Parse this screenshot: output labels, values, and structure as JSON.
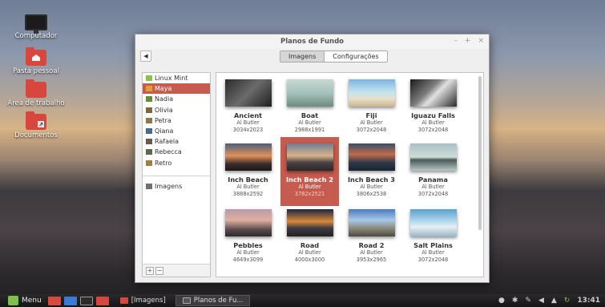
{
  "desktop": {
    "icons": [
      {
        "label": "Computador",
        "icon": "computer-icon"
      },
      {
        "label": "Pasta pessoal",
        "icon": "home-folder-icon"
      },
      {
        "label": "Área de trabalho",
        "icon": "folder-icon"
      },
      {
        "label": "Documentos",
        "icon": "folder-link-icon"
      }
    ]
  },
  "window": {
    "title": "Planos de Fundo",
    "controls": {
      "minimize": "–",
      "maximize": "+",
      "close": "×"
    },
    "back": "◀",
    "tabs": [
      {
        "label": "Imagens",
        "active": true
      },
      {
        "label": "Configurações",
        "active": false
      }
    ]
  },
  "sidebar": {
    "items": [
      {
        "label": "Linux Mint",
        "color": "#8bc34a"
      },
      {
        "label": "Maya",
        "color": "#e0a030",
        "selected": true
      },
      {
        "label": "Nadia",
        "color": "#6a8a3a"
      },
      {
        "label": "Olivia",
        "color": "#7a6a3a"
      },
      {
        "label": "Petra",
        "color": "#8a7a4a"
      },
      {
        "label": "Qiana",
        "color": "#4a6a8a"
      },
      {
        "label": "Rafaela",
        "color": "#6a5a4a"
      },
      {
        "label": "Rebecca",
        "color": "#5a6a4a"
      },
      {
        "label": "Retro",
        "color": "#a08040"
      }
    ],
    "user_items": [
      {
        "label": "Imagens",
        "color": "#707070"
      }
    ],
    "add": "+",
    "remove": "−"
  },
  "wallpapers": [
    {
      "name": "Ancient",
      "author": "Al Butler",
      "size": "3034x2023"
    },
    {
      "name": "Boat",
      "author": "Al Butler",
      "size": "2988x1991"
    },
    {
      "name": "Fiji",
      "author": "Al Butler",
      "size": "3072x2048"
    },
    {
      "name": "Iguazu Falls",
      "author": "Al Butler",
      "size": "3072x2048"
    },
    {
      "name": "Inch Beach",
      "author": "Al Butler",
      "size": "3888x2592"
    },
    {
      "name": "Inch Beach 2",
      "author": "Al Butler",
      "size": "3782x2521",
      "selected": true
    },
    {
      "name": "Inch Beach 3",
      "author": "Al Butler",
      "size": "3806x2538"
    },
    {
      "name": "Panama",
      "author": "Al Butler",
      "size": "3072x2048"
    },
    {
      "name": "Pebbles",
      "author": "Al Butler",
      "size": "4649x3099"
    },
    {
      "name": "Road",
      "author": "Al Butler",
      "size": "4000x3000"
    },
    {
      "name": "Road 2",
      "author": "Al Butler",
      "size": "3953x2965"
    },
    {
      "name": "Salt Plains",
      "author": "Al Butler",
      "size": "3072x2048"
    }
  ],
  "taskbar": {
    "menu_label": "Menu",
    "tasks": [
      {
        "label": "[Imagens]",
        "active": false
      },
      {
        "label": "Planos de Fu...",
        "active": true
      }
    ],
    "clock": "13:41"
  },
  "colors": {
    "accent": "#c65b4f",
    "panel": "#1c1c1c"
  }
}
